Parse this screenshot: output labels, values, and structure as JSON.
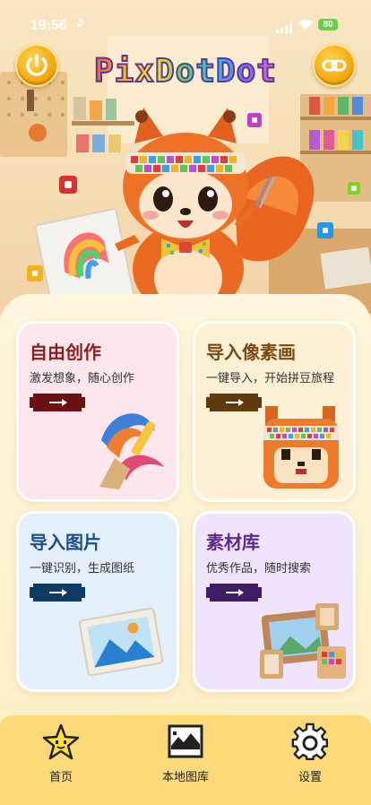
{
  "status_bar": {
    "time": "19:56",
    "battery": "80"
  },
  "app": {
    "title": "PixDotDot"
  },
  "cards": [
    {
      "title": "自由创作",
      "subtitle": "激发想象，随心创作"
    },
    {
      "title": "导入像素画",
      "subtitle": "一键导入，开始拼豆旅程"
    },
    {
      "title": "导入图片",
      "subtitle": "一键识别，生成图纸"
    },
    {
      "title": "素材库",
      "subtitle": "优秀作品，随时搜索"
    }
  ],
  "nav": [
    {
      "label": "首页"
    },
    {
      "label": "本地图库"
    },
    {
      "label": "设置"
    }
  ],
  "colors": {
    "card1_title": "#8b1e1e",
    "card2_title": "#7a4a12",
    "card3_title": "#1d4e87",
    "card4_title": "#5b2a8a"
  }
}
